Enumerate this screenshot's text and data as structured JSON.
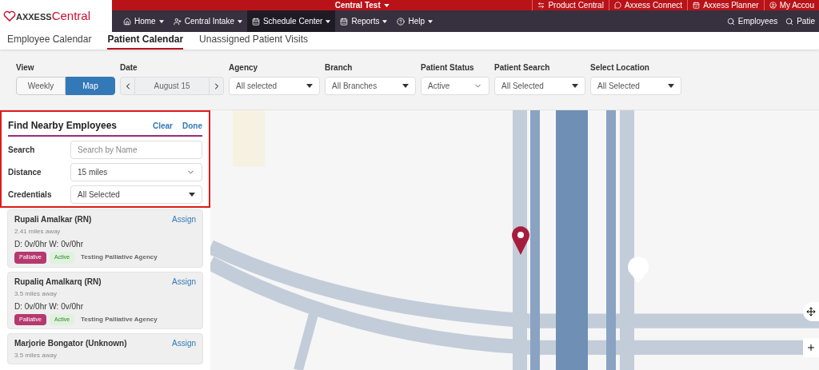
{
  "logo": {
    "brand_a": "AXXESS",
    "brand_b": "Central"
  },
  "top_bar": {
    "title": "Central Test",
    "links": [
      {
        "label": "Product Central"
      },
      {
        "label": "Axxess Connect"
      },
      {
        "label": "Axxess Planner"
      },
      {
        "label": "My Accou"
      }
    ]
  },
  "nav": {
    "items": [
      {
        "label": "Home",
        "selected": false
      },
      {
        "label": "Central Intake",
        "selected": false
      },
      {
        "label": "Schedule Center",
        "selected": true
      },
      {
        "label": "Reports",
        "selected": false
      },
      {
        "label": "Help",
        "selected": false
      }
    ],
    "search_links": [
      "Employees",
      "Patie"
    ]
  },
  "tabs": [
    {
      "label": "Employee Calendar",
      "selected": false
    },
    {
      "label": "Patient Calendar",
      "selected": true
    },
    {
      "label": "Unassigned Patient Visits",
      "selected": false
    }
  ],
  "filters": {
    "view": {
      "label": "View",
      "options": [
        {
          "label": "Weekly",
          "selected": false
        },
        {
          "label": "Map",
          "selected": true
        }
      ]
    },
    "date": {
      "label": "Date",
      "value": "August 15"
    },
    "selects": [
      {
        "label": "Agency",
        "value": "All selected",
        "kind": "caret"
      },
      {
        "label": "Branch",
        "value": "All Branches",
        "kind": "caret"
      },
      {
        "label": "Patient Status",
        "value": "Active",
        "kind": "chevron"
      },
      {
        "label": "Patient Search",
        "value": "All Selected",
        "kind": "caret"
      },
      {
        "label": "Select Location",
        "value": "All Selected",
        "kind": "caret"
      }
    ]
  },
  "find_panel": {
    "title": "Find Nearby Employees",
    "actions": [
      "Clear",
      "Done"
    ],
    "search": {
      "label": "Search",
      "placeholder": "Search by Name"
    },
    "distance": {
      "label": "Distance",
      "value": "15 miles"
    },
    "credentials": {
      "label": "Credentials",
      "value": "All Selected"
    }
  },
  "employees": [
    {
      "name": "Rupali Amalkar (RN)",
      "action": "Assign",
      "distance": "2.41 miles away",
      "hours": "D: 0v/0hr W: 0v/0hr",
      "tags": [
        {
          "label": "Palliative",
          "color": "#b5396f"
        },
        {
          "label": "Active",
          "color": "#dff3dc"
        }
      ],
      "agency": "Testing Palliative Agency"
    },
    {
      "name": "Rupaliq Amalkarq (RN)",
      "action": "Assign",
      "distance": "3.5 miles away",
      "hours": "D: 0v/0hr W: 0v/0hr",
      "tags": [
        {
          "label": "Palliative",
          "color": "#b5396f"
        },
        {
          "label": "Active",
          "color": "#dff3dc"
        }
      ],
      "agency": "Testing Palliative Agency"
    },
    {
      "name": "Marjorie Bongator (Unknown)",
      "action": "Assign",
      "distance": "3.5 miles away"
    }
  ]
}
